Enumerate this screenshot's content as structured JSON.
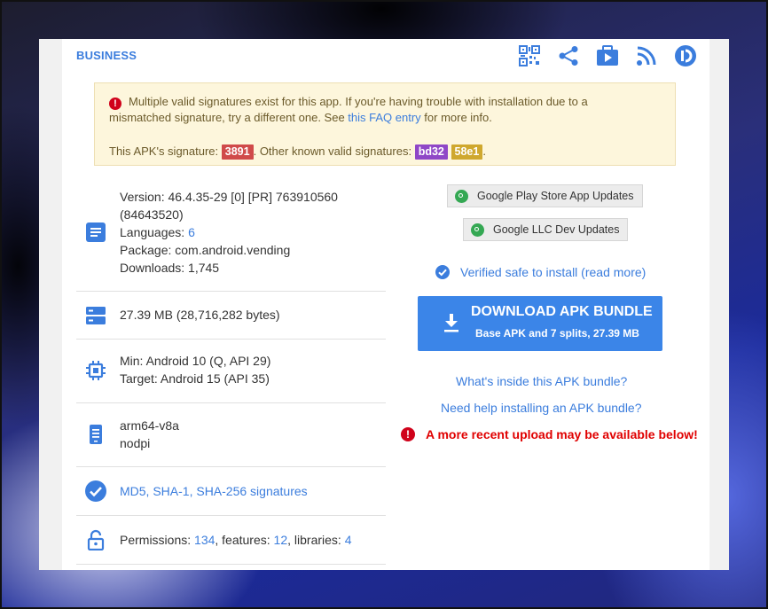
{
  "header": {
    "category": "BUSINESS",
    "icons": [
      "qr-code-icon",
      "share-icon",
      "play-store-icon",
      "rss-icon",
      "apkmirror-icon"
    ]
  },
  "alert": {
    "line1": "Multiple valid signatures exist for this app. If you're having trouble with installation due to a",
    "line2_pre": "mismatched signature, try a different one. See ",
    "faq_link": "this FAQ entry",
    "line2_post": " for more info.",
    "sig_label": "This APK's signature:",
    "sig_value": "3891",
    "other_label": ". Other known valid signatures:",
    "other_sigs": [
      "bd32",
      "58e1"
    ],
    "end": "."
  },
  "details": {
    "version_line1": "Version: 46.4.35-29 [0] [PR] 763910560",
    "version_line2": "(84643520)",
    "languages_label": "Languages:",
    "languages_count": "6",
    "package": "Package: com.android.vending",
    "downloads": "Downloads: 1,745",
    "size": "27.39 MB (28,716,282 bytes)",
    "min_sdk": "Min: Android 10 (Q, API 29)",
    "target_sdk": "Target: Android 15 (API 35)",
    "arch": "arm64-v8a",
    "dpi": "nodpi",
    "signatures_link": "MD5, SHA-1, SHA-256 signatures",
    "permissions_label": "Permissions:",
    "permissions_count": "134",
    "features_label": ", features:",
    "features_count": "12",
    "libraries_label": ", libraries:",
    "libraries_count": "4"
  },
  "right": {
    "pill1": "Google Play Store App Updates",
    "pill2": "Google LLC Dev Updates",
    "verified": "Verified safe to install (read more)",
    "download_title": "DOWNLOAD APK BUNDLE",
    "download_sub": "Base APK and 7 splits, 27.39 MB",
    "whats_inside": "What's inside this APK bundle?",
    "need_help": "Need help installing an APK bundle?",
    "warning": "A more recent upload may be available below!"
  },
  "colors": {
    "accent": "#3b7ddd",
    "sig_red": "#d04a4a",
    "sig_purple": "#8f47c7",
    "sig_gold": "#cfa82e",
    "warning_red": "#e00000",
    "download_blue": "#3b85e8"
  }
}
